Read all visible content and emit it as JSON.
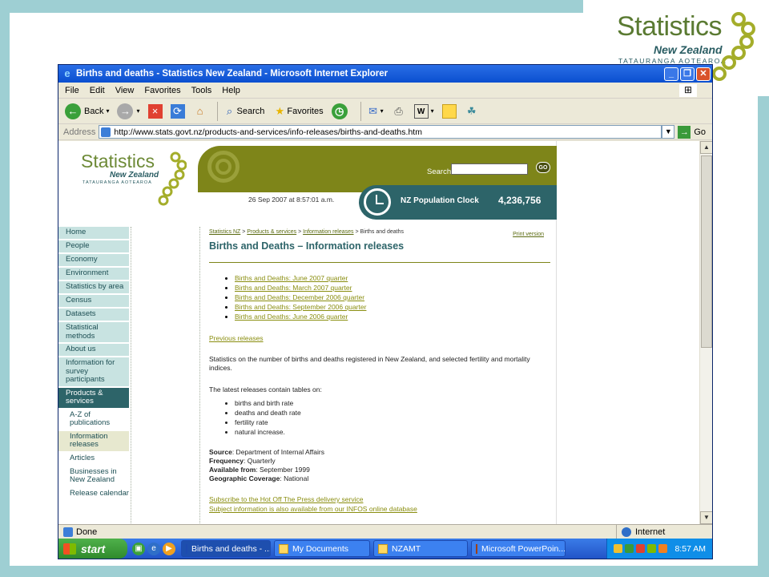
{
  "slide": {
    "logo_title": "Statistics",
    "logo_sub": "New Zealand",
    "logo_maori": "TATAURANGA AOTEAROA"
  },
  "window": {
    "title": "Births and deaths - Statistics New Zealand - Microsoft Internet Explorer",
    "menus": [
      "File",
      "Edit",
      "View",
      "Favorites",
      "Tools",
      "Help"
    ],
    "toolbar": {
      "back": "Back",
      "search": "Search",
      "favorites": "Favorites"
    },
    "address_label": "Address",
    "address_url": "http://www.stats.govt.nz/products-and-services/info-releases/births-and-deaths.htm",
    "go_label": "Go"
  },
  "site": {
    "logo_title": "Statistics",
    "logo_sub": "New Zealand",
    "logo_maori": "TATAURANGA AOTEAROA",
    "search_label": "Search",
    "search_go": "GO",
    "datetime": "26 Sep 2007 at 8:57:01 a.m.",
    "clock_label": "NZ Population Clock",
    "clock_value": "4,236,756"
  },
  "nav": [
    {
      "label": "Home",
      "kind": "main"
    },
    {
      "label": "People",
      "kind": "main"
    },
    {
      "label": "Economy",
      "kind": "main"
    },
    {
      "label": "Environment",
      "kind": "main"
    },
    {
      "label": "Statistics by area",
      "kind": "main"
    },
    {
      "label": "Census",
      "kind": "main"
    },
    {
      "label": "Datasets",
      "kind": "main"
    },
    {
      "label": "Statistical methods",
      "kind": "main"
    },
    {
      "label": "About us",
      "kind": "main"
    },
    {
      "label": "Information for survey participants",
      "kind": "main"
    },
    {
      "label": "Products & services",
      "kind": "active"
    },
    {
      "label": "A-Z of publications",
      "kind": "sub"
    },
    {
      "label": "Information releases",
      "kind": "sub-selected"
    },
    {
      "label": "Articles",
      "kind": "sub"
    },
    {
      "label": "Businesses in New Zealand",
      "kind": "sub"
    },
    {
      "label": "Release calendar",
      "kind": "sub"
    }
  ],
  "content": {
    "breadcrumb": {
      "c1": "Statistics NZ",
      "c2": "Products & services",
      "c3": "Information releases",
      "current": "Births and deaths",
      "sep": " > "
    },
    "print_version": "Print version",
    "title": "Births and Deaths – Information releases",
    "releases": [
      "Births and Deaths: June 2007 quarter",
      "Births and Deaths: March 2007 quarter",
      "Births and Deaths: December 2006 quarter",
      "Births and Deaths: September 2006 quarter",
      "Births and Deaths: June 2006 quarter"
    ],
    "previous": "Previous releases",
    "intro": "Statistics on the number of births and deaths registered in New Zealand, and selected fertility and mortality indices.",
    "tables_intro": "The latest releases contain tables on:",
    "tables": [
      "births and birth rate",
      "deaths and death rate",
      "fertility rate",
      "natural increase."
    ],
    "meta": {
      "source_k": "Source",
      "source_v": ": Department of Internal Affairs",
      "freq_k": "Frequency",
      "freq_v": ": Quarterly",
      "avail_k": "Available from",
      "avail_v": ": September 1999",
      "geo_k": "Geographic Coverage",
      "geo_v": ": National"
    },
    "link1": "Subscribe to the Hot Off The Press delivery service",
    "link2": "Subject information is also available from our INFOS online database"
  },
  "status": {
    "left": "Done",
    "zone": "Internet"
  },
  "taskbar": {
    "start": "start",
    "tasks": [
      "Births and deaths - ...",
      "My Documents",
      "NZAMT",
      "Microsoft PowerPoin..."
    ],
    "clock": "8:57 AM"
  }
}
